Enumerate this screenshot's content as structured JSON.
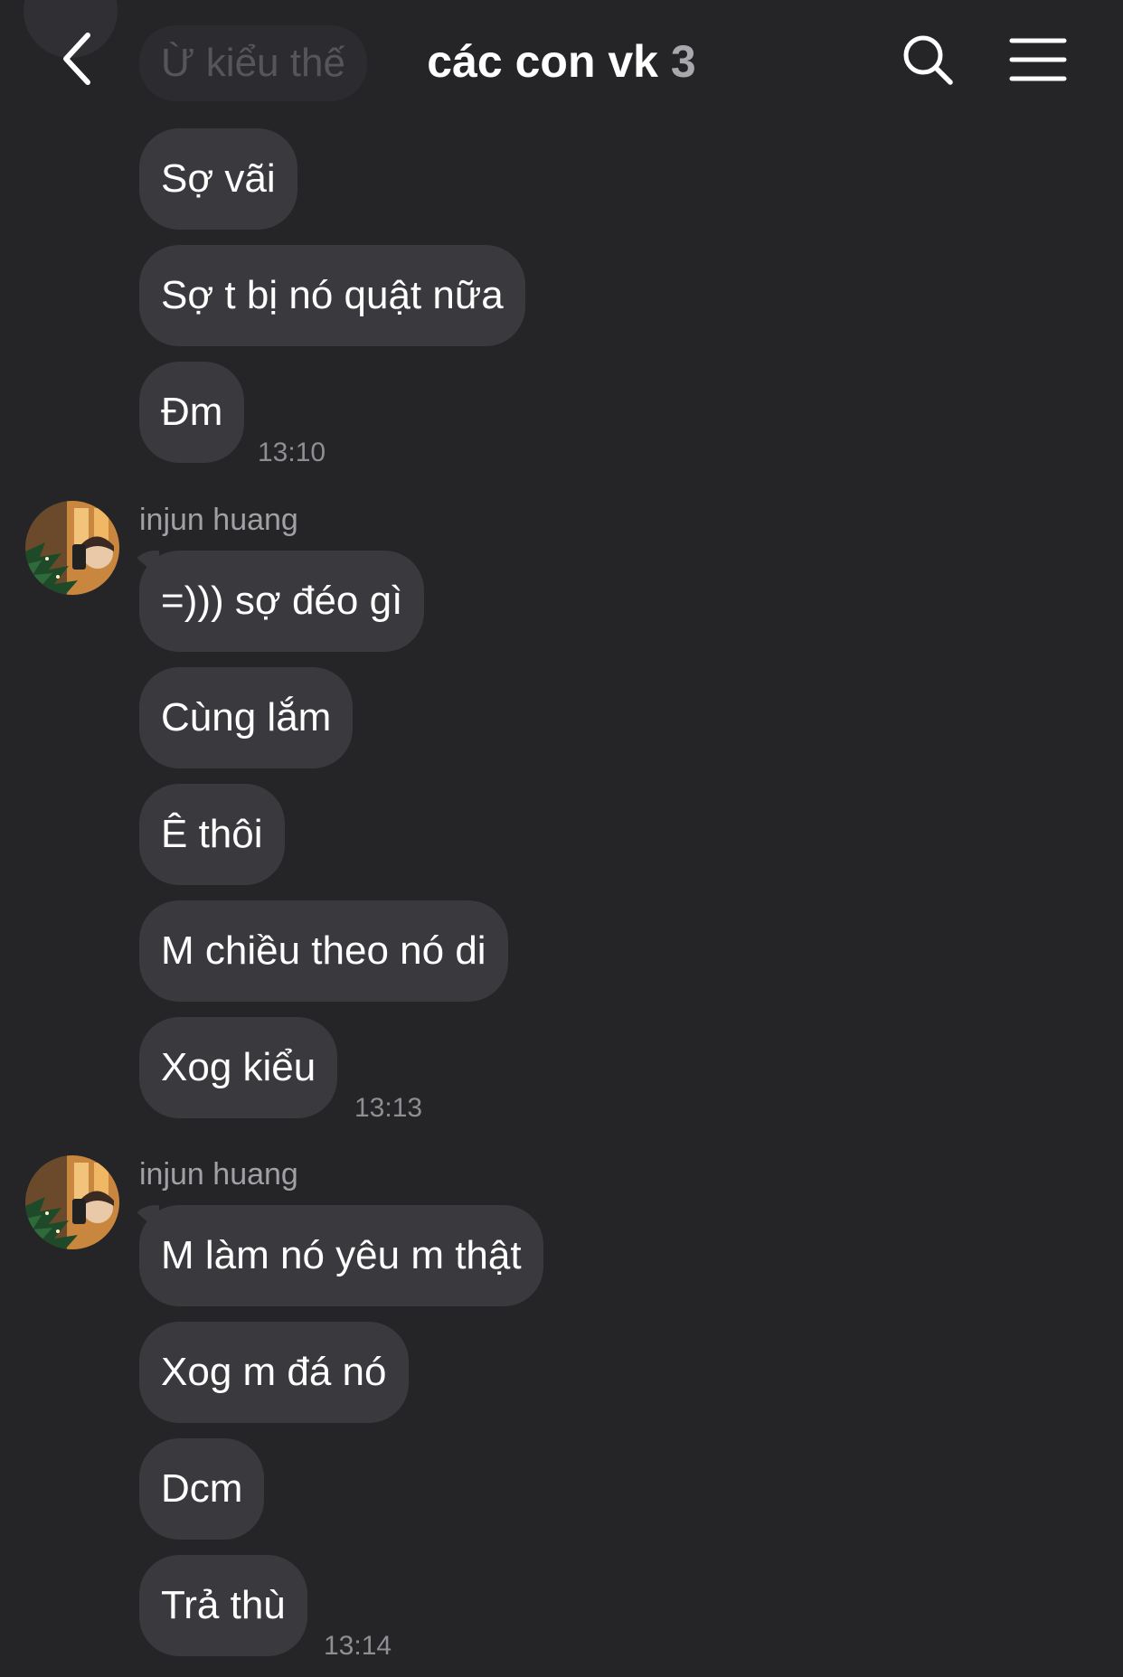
{
  "header": {
    "title": "các con vk",
    "member_count": "3"
  },
  "previous_message": "Ừ kiểu thế",
  "messages": [
    {
      "text": "Sợ vãi"
    },
    {
      "text": "Sợ t bị nó quật nữa"
    },
    {
      "text": "Đm",
      "time": "13:10"
    },
    {
      "sender": "injun huang",
      "text": "=))) sợ đéo gì"
    },
    {
      "text": "Cùng lắm"
    },
    {
      "text": "Ê thôi"
    },
    {
      "text": "M chiều theo nó di"
    },
    {
      "text": "Xog kiểu",
      "time": "13:13"
    },
    {
      "sender": "injun huang",
      "text": "M làm nó yêu m thật"
    },
    {
      "text": "Xog m đá nó"
    },
    {
      "text": "Dcm"
    },
    {
      "text": "Trả thù",
      "time": "13:14"
    }
  ],
  "colors": {
    "background": "#252528",
    "bubble": "#3a3a3e",
    "secondary_text": "#8e8e93"
  }
}
